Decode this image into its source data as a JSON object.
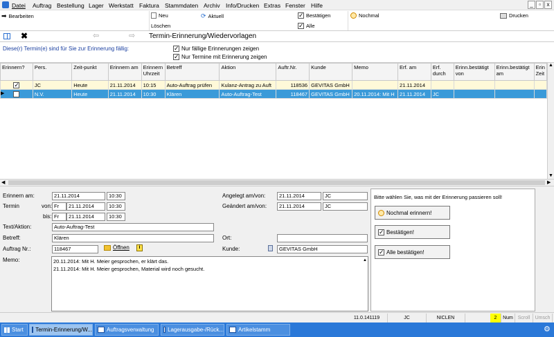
{
  "menu": {
    "items": [
      "Datei",
      "Auftrag",
      "Bestellung",
      "Lager",
      "Werkstatt",
      "Faktura",
      "Stammdaten",
      "Archiv",
      "Info/Drucken",
      "Extras",
      "Fenster",
      "Hilfe"
    ],
    "win_controls": [
      "_",
      "▫",
      "x"
    ]
  },
  "toolbar": {
    "bearbeiten": "Bearbeiten",
    "neu": "Neu",
    "loeschen": "Löschen",
    "aktuell": "Aktuell",
    "bestaetigen": "Bestätigen",
    "alle": "Alle",
    "nochmal": "Nochmal",
    "drucken": "Drucken"
  },
  "window": {
    "title": "Termin-Erinnerung/Wiedervorlagen"
  },
  "filter": {
    "info": "Diese(r) Termin(e) sind für Sie zur Erinnerung fällig:",
    "opt1": "Nur fällige Erinnerungen zeigen",
    "opt2": "Nur Termine mit Erinnerung zeigen"
  },
  "grid": {
    "columns": [
      "Erinnern?",
      "Pers.",
      "Zeit-punkt",
      "Erinnern am",
      "Erinnern Uhrzeit",
      "Betreff",
      "Aktion",
      "Auftr.Nr.",
      "Kunde",
      "Memo",
      "Erf. am",
      "Erf. durch",
      "Erinn.bestätigt von",
      "Erinn.bestätigt am",
      "Erin Zeit"
    ],
    "rows": [
      [
        "",
        "JC",
        "Heute",
        "21.11.2014",
        "10:15",
        "Auto-Auftrag prüfen",
        "Kulanz-Antrag zu Auft",
        "118536",
        "GEVITAS GmbH",
        "",
        "21.11.2014",
        "",
        "",
        "",
        ""
      ],
      [
        "",
        "N.V.",
        "Heute",
        "21.11.2014",
        "10:30",
        "Klären",
        "Auto-Auftrag-Test",
        "118467",
        "GEVITAS GmbH",
        "20.11.2014: Mit H",
        "21.11.2014",
        "JC",
        "",
        "",
        ""
      ]
    ]
  },
  "detail": {
    "erinnern_am_label": "Erinnern am:",
    "erinnern_am_date": "21.11.2014",
    "erinnern_am_time": "10:30",
    "termin_label": "Termin",
    "von_label": "von:",
    "von_day": "Fr",
    "von_date": "21.11.2014",
    "von_time": "10:30",
    "bis_label": "bis:",
    "bis_day": "Fr",
    "bis_date": "21.11.2014",
    "bis_time": "10:30",
    "angelegt_label": "Angelegt am/von:",
    "angelegt_date": "21.11.2014",
    "angelegt_by": "JC",
    "geaendert_label": "Geändert am/von:",
    "geaendert_date": "21.11.2014",
    "geaendert_by": "JC",
    "text_aktion_label": "Text/Aktion:",
    "text_aktion": "Auto-Auftrag-Test",
    "betreff_label": "Betreff:",
    "betreff": "Klären",
    "ort_label": "Ort:",
    "ort": "",
    "auftrag_label": "Auftrag Nr.:",
    "auftrag": "118467",
    "oeffnen": "Öffnen",
    "kunde_label": "Kunde:",
    "kunde": "GEVITAS GmbH",
    "memo_label": "Memo:",
    "memo_lines": [
      "20.11.2014: Mit H. Meier gesprochen, er klärt das.",
      "21.11.2014: Mit H. Meier gesprochen, Material wird noch gesucht."
    ]
  },
  "action_panel": {
    "prompt": "Bitte wählen Sie, was mit der Erinnerung passieren soll!",
    "btn_nochmal": "Nochmal erinnern!",
    "btn_bestaetigen": "Bestätigen!",
    "btn_alle": "Alle bestätigen!"
  },
  "status": {
    "version": "11.0.141119",
    "user": "JC",
    "machine": "NICLEN",
    "count": "2",
    "num": "Num",
    "scroll": "Scroll",
    "umsch": "Umsch"
  },
  "taskbar": {
    "start": "Start",
    "tasks": [
      "Termin-Erinnerung/W...",
      "Auftragsverwaltung",
      "Lagerausgabe-/Rück...",
      "Artikelstamm"
    ]
  },
  "colors": {
    "selected_row": "#3a9ad9",
    "highlight_row": "#fff9d9",
    "taskbar": "#2a78d8",
    "count_badge": "#ffff00"
  }
}
